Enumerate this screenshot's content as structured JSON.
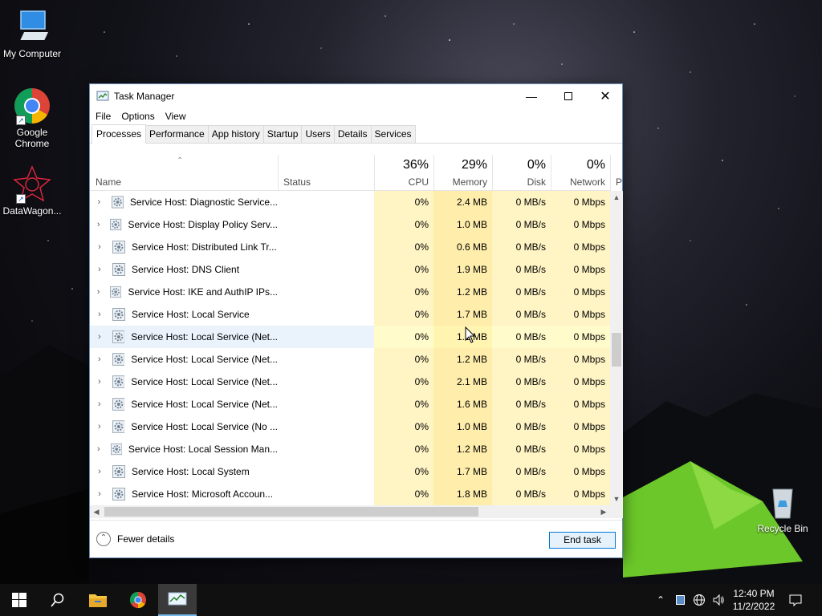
{
  "desktop": {
    "icons": [
      {
        "label": "My Computer"
      },
      {
        "label": "Google Chrome"
      },
      {
        "label": "DataWagon..."
      },
      {
        "label": "Recycle Bin"
      }
    ]
  },
  "window": {
    "title": "Task Manager",
    "menu": [
      "File",
      "Options",
      "View"
    ],
    "tabs": [
      "Processes",
      "Performance",
      "App history",
      "Startup",
      "Users",
      "Details",
      "Services"
    ],
    "active_tab": "Processes",
    "columns": {
      "name": "Name",
      "status": "Status",
      "cpu": {
        "label": "CPU",
        "pct": "36%"
      },
      "memory": {
        "label": "Memory",
        "pct": "29%"
      },
      "disk": {
        "label": "Disk",
        "pct": "0%"
      },
      "network": {
        "label": "Network",
        "pct": "0%"
      },
      "power": "P"
    },
    "processes": [
      {
        "name": "Service Host: Diagnostic Service...",
        "cpu": "0%",
        "memory": "2.4 MB",
        "disk": "0 MB/s",
        "network": "0 Mbps"
      },
      {
        "name": "Service Host: Display Policy Serv...",
        "cpu": "0%",
        "memory": "1.0 MB",
        "disk": "0 MB/s",
        "network": "0 Mbps"
      },
      {
        "name": "Service Host: Distributed Link Tr...",
        "cpu": "0%",
        "memory": "0.6 MB",
        "disk": "0 MB/s",
        "network": "0 Mbps"
      },
      {
        "name": "Service Host: DNS Client",
        "cpu": "0%",
        "memory": "1.9 MB",
        "disk": "0 MB/s",
        "network": "0 Mbps"
      },
      {
        "name": "Service Host: IKE and AuthIP IPs...",
        "cpu": "0%",
        "memory": "1.2 MB",
        "disk": "0 MB/s",
        "network": "0 Mbps"
      },
      {
        "name": "Service Host: Local Service",
        "cpu": "0%",
        "memory": "1.7 MB",
        "disk": "0 MB/s",
        "network": "0 Mbps"
      },
      {
        "name": "Service Host: Local Service (Net...",
        "cpu": "0%",
        "memory": "1.1 MB",
        "disk": "0 MB/s",
        "network": "0 Mbps"
      },
      {
        "name": "Service Host: Local Service (Net...",
        "cpu": "0%",
        "memory": "1.2 MB",
        "disk": "0 MB/s",
        "network": "0 Mbps"
      },
      {
        "name": "Service Host: Local Service (Net...",
        "cpu": "0%",
        "memory": "2.1 MB",
        "disk": "0 MB/s",
        "network": "0 Mbps"
      },
      {
        "name": "Service Host: Local Service (Net...",
        "cpu": "0%",
        "memory": "1.6 MB",
        "disk": "0 MB/s",
        "network": "0 Mbps"
      },
      {
        "name": "Service Host: Local Service (No ...",
        "cpu": "0%",
        "memory": "1.0 MB",
        "disk": "0 MB/s",
        "network": "0 Mbps"
      },
      {
        "name": "Service Host: Local Session Man...",
        "cpu": "0%",
        "memory": "1.2 MB",
        "disk": "0 MB/s",
        "network": "0 Mbps"
      },
      {
        "name": "Service Host: Local System",
        "cpu": "0%",
        "memory": "1.7 MB",
        "disk": "0 MB/s",
        "network": "0 Mbps"
      },
      {
        "name": "Service Host: Microsoft Accoun...",
        "cpu": "0%",
        "memory": "1.8 MB",
        "disk": "0 MB/s",
        "network": "0 Mbps"
      }
    ],
    "fewer_details": "Fewer details",
    "end_task": "End task"
  },
  "taskbar": {
    "time": "12:40 PM",
    "date": "11/2/2022"
  },
  "colors": {
    "cpu_bg": "#fff4c4",
    "memory_bg": "#ffedab",
    "selected_row": "#eaf3fc",
    "accent": "#0078d7",
    "taskbar": "#101010"
  }
}
